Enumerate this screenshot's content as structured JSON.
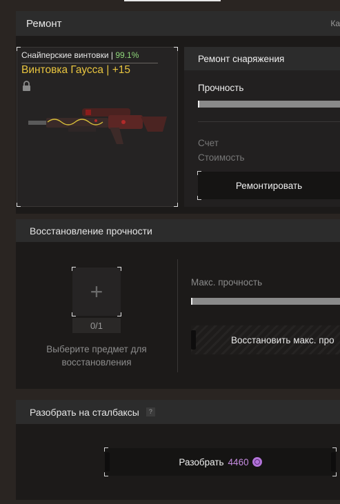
{
  "repair_panel": {
    "title": "Ремонт",
    "cut_label": "Ка"
  },
  "item": {
    "category": "Снайперские винтовки",
    "separator": "|",
    "durability_pct": "99.1%",
    "name": "Винтовка Гаусса | +15",
    "locked_icon": "lock-icon"
  },
  "equipment_repair": {
    "title": "Ремонт снаряжения",
    "durability_label": "Прочность",
    "durability_fraction": 0.99,
    "account_label": "Счет",
    "cost_label": "Стоимость",
    "repair_button": "Ремонтировать"
  },
  "restore": {
    "title": "Восстановление прочности",
    "slot_icon": "plus-icon",
    "slot_count": "0/1",
    "hint": "Выберите предмет для восстановления",
    "max_durability_label": "Макс. прочность",
    "max_durability_fraction": 0.99,
    "restore_button": "Восстановить макс. про"
  },
  "disassemble": {
    "title": "Разобрать на сталбаксы",
    "help": "?",
    "button_label": "Разобрать",
    "price": "4460",
    "currency_icon": "stalbucks-coin-icon"
  },
  "colors": {
    "accent_yellow": "#e9c53f",
    "accent_green": "#8fd77a",
    "accent_purple": "#c58be0"
  }
}
